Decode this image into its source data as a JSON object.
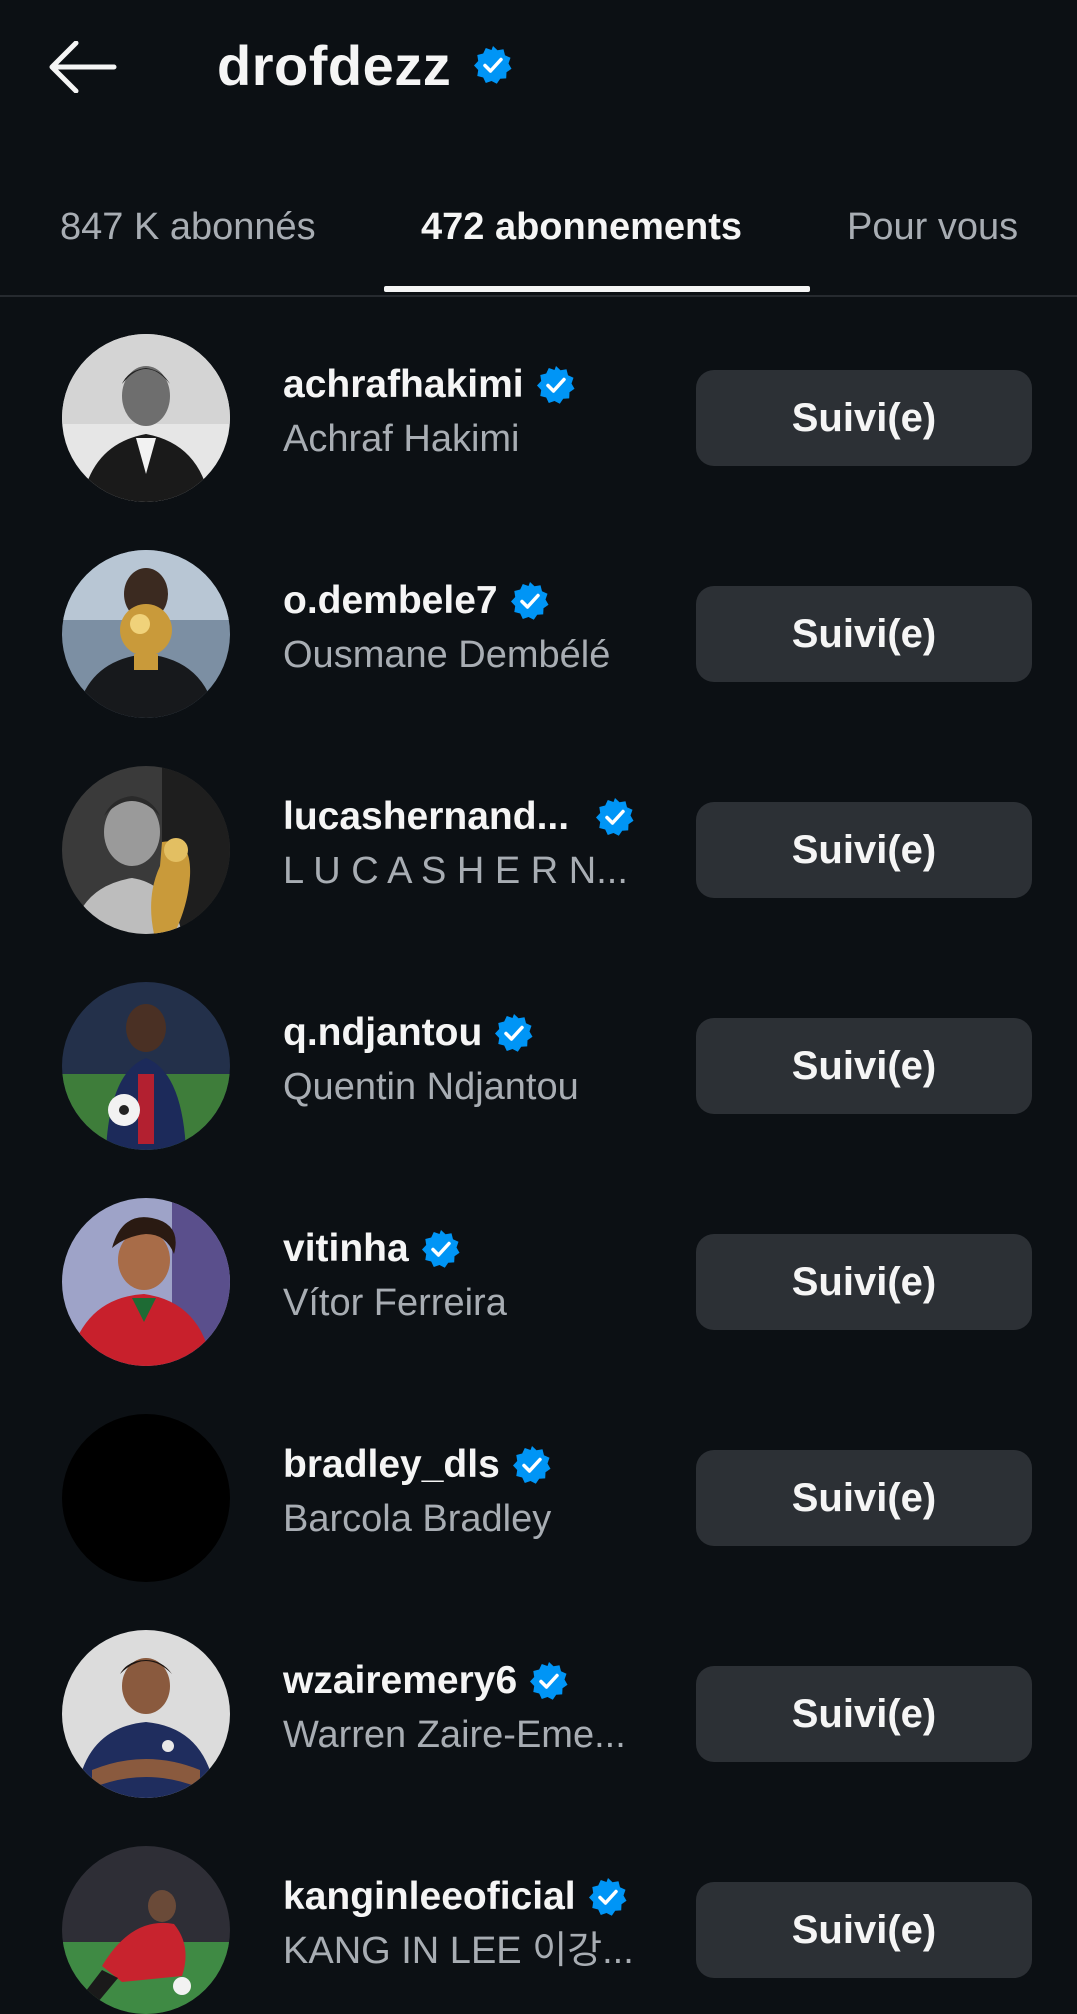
{
  "header": {
    "title": "drofdezz",
    "back_icon": "arrow-left-icon",
    "verified": true
  },
  "tabs": [
    {
      "label": "847 K abonnés",
      "active": false
    },
    {
      "label": "472 abonnements",
      "active": true
    },
    {
      "label": "Pour vous",
      "active": false
    }
  ],
  "colors": {
    "background": "#0c1014",
    "verified_blue": "#0095f6",
    "button_bg": "#2c3035",
    "secondary_text": "#a8adb3"
  },
  "follow_list": [
    {
      "username": "achrafhakimi",
      "name": "Achraf Hakimi",
      "button": "Suivi(e)",
      "verified": true
    },
    {
      "username": "o.dembele7",
      "name": "Ousmane Dembélé",
      "button": "Suivi(e)",
      "verified": true
    },
    {
      "username": "lucashernand...",
      "name": "L U C A S  H E R N...",
      "button": "Suivi(e)",
      "verified": true
    },
    {
      "username": "q.ndjantou",
      "name": "Quentin Ndjantou",
      "button": "Suivi(e)",
      "verified": true
    },
    {
      "username": "vitinha",
      "name": "Vítor Ferreira",
      "button": "Suivi(e)",
      "verified": true
    },
    {
      "username": "bradley_dls",
      "name": "Barcola Bradley",
      "button": "Suivi(e)",
      "verified": true
    },
    {
      "username": "wzairemery6",
      "name": "Warren Zaire-Eme...",
      "button": "Suivi(e)",
      "verified": true
    },
    {
      "username": "kanginleeoficial",
      "name": "KANG IN LEE 이강...",
      "button": "Suivi(e)",
      "verified": true
    }
  ]
}
